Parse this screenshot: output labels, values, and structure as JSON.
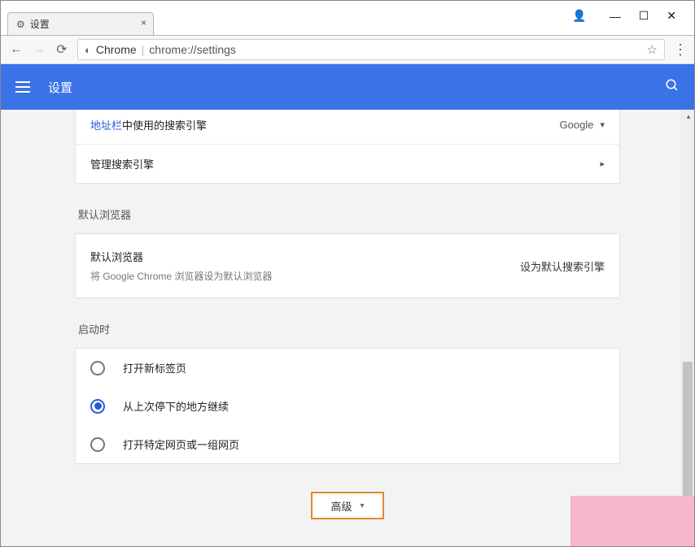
{
  "window": {
    "tab_title": "设置",
    "avatar_glyph": "👤",
    "minimize": "—",
    "maximize": "☐",
    "close": "✕",
    "tab_close": "×"
  },
  "nav": {
    "back": "←",
    "forward": "→",
    "reload": "⟳",
    "info_glyph": "◐",
    "host": "Chrome",
    "path": "chrome://settings",
    "star": "☆",
    "kebab": "⋮"
  },
  "header": {
    "title": "设置",
    "search_glyph": "🔍"
  },
  "search_engine": {
    "label_prefix_link": "地址栏",
    "label_suffix": "中使用的搜索引擎",
    "value": "Google",
    "manage_label": "管理搜索引擎",
    "manage_caret": "▸",
    "dropdown_caret": "▾"
  },
  "default_browser": {
    "section_label": "默认浏览器",
    "subtitle": "默认浏览器",
    "desc": "将 Google Chrome 浏览器设为默认浏览器",
    "action": "设为默认搜索引擎"
  },
  "startup": {
    "section_label": "启动时",
    "options": [
      "打开新标签页",
      "从上次停下的地方继续",
      "打开特定网页或一组网页"
    ],
    "selected_index": 1
  },
  "advanced": {
    "label": "高级",
    "caret": "▾"
  },
  "scrollbar": {
    "up": "▴",
    "down": "▾"
  }
}
